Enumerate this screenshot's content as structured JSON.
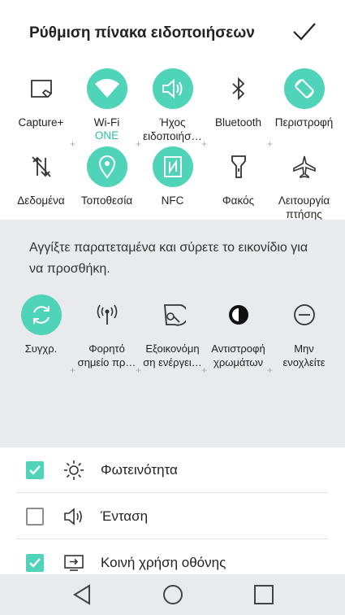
{
  "header": {
    "title": "Ρύθμιση πίνακα ειδοποιήσεων"
  },
  "active_tiles": [
    {
      "label": "Capture+",
      "sub": "",
      "on": false
    },
    {
      "label": "Wi-Fi",
      "sub": "ONE",
      "on": true
    },
    {
      "label": "Ήχος\nειδοποιήσ…",
      "sub": "",
      "on": true
    },
    {
      "label": "Bluetooth",
      "sub": "",
      "on": false
    },
    {
      "label": "Περιστροφή",
      "sub": "",
      "on": true
    },
    {
      "label": "Δεδομένα",
      "sub": "",
      "on": false
    },
    {
      "label": "Τοποθεσία",
      "sub": "",
      "on": true
    },
    {
      "label": "NFC",
      "sub": "",
      "on": true
    },
    {
      "label": "Φακός",
      "sub": "",
      "on": false
    },
    {
      "label": "Λειτουργία\nπτήσης",
      "sub": "",
      "on": false
    }
  ],
  "inactive": {
    "hint": "Αγγίξτε παρατεταμένα και σύρετε το εικονίδιο για να προσθήκη.",
    "tiles": [
      {
        "label": "Συγχρ.",
        "on": true
      },
      {
        "label": "Φορητό\nσημείο πρ…",
        "on": false
      },
      {
        "label": "Εξοικονόμη\nση ενέργει…",
        "on": false
      },
      {
        "label": "Αντιστροφή\nχρωμάτων",
        "on": false
      },
      {
        "label": "Μην\nενοχλείτε",
        "on": false
      }
    ]
  },
  "settings": [
    {
      "label": "Φωτεινότητα",
      "checked": true,
      "icon": "brightness-icon"
    },
    {
      "label": "Ένταση",
      "checked": false,
      "icon": "volume-icon"
    },
    {
      "label": "Κοινή χρήση οθόνης",
      "checked": true,
      "icon": "screen-share-icon"
    }
  ],
  "colors": {
    "accent": "#4fd3b9",
    "panel_bg": "#e9eaee"
  }
}
